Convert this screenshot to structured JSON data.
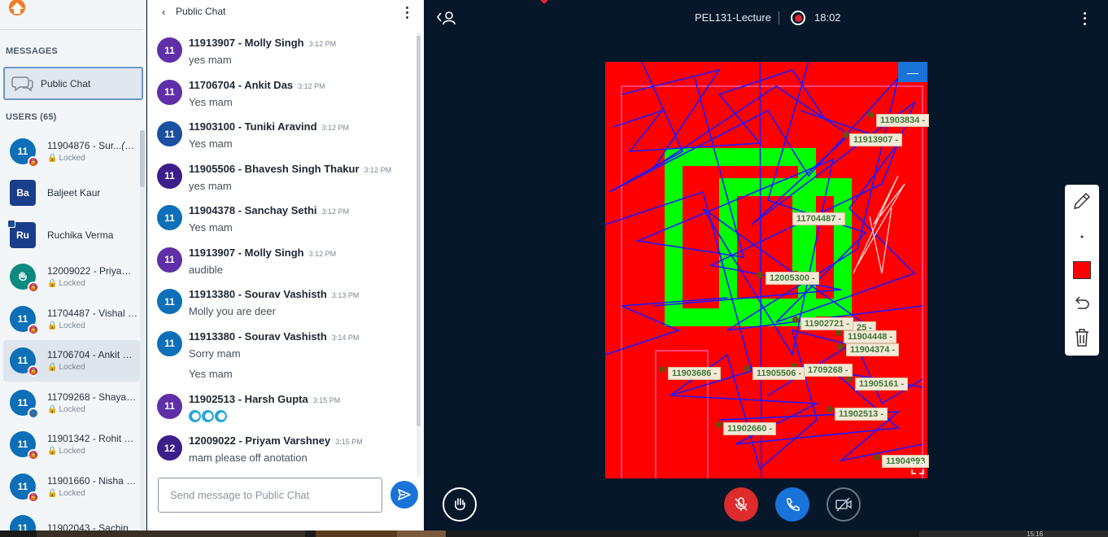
{
  "sidebar": {
    "messages_title": "MESSAGES",
    "public_chat_label": "Public Chat",
    "users_title": "USERS (65)",
    "users": [
      {
        "avatar": "11",
        "name": "11904876 - Sur...",
        "you": "(You)",
        "status": "Locked",
        "badge": "lock-red"
      },
      {
        "avatar": "Ba",
        "name": "Baljeet Kaur",
        "status": "",
        "badge": ""
      },
      {
        "avatar": "Ru",
        "name": "Ruchika Verma",
        "status": "",
        "badge": ""
      },
      {
        "avatar": "hand",
        "name": "12009022 - Priyam ...",
        "status": "Locked",
        "badge": "lock-red"
      },
      {
        "avatar": "11",
        "name": "11704487 - Vishal G...",
        "status": "Locked",
        "badge": "lock-red"
      },
      {
        "avatar": "11",
        "name": "11706704 - Ankit Das",
        "status": "Locked",
        "badge": "lock-red"
      },
      {
        "avatar": "11",
        "name": "11709268 - Shayan ...",
        "status": "Locked",
        "badge": "headset-blue"
      },
      {
        "avatar": "11",
        "name": "11901342 - Rohit M...",
        "status": "Locked",
        "badge": "lock-red"
      },
      {
        "avatar": "11",
        "name": "11901660 - Nisha K...",
        "status": "Locked",
        "badge": "lock-red"
      },
      {
        "avatar": "11",
        "name": "11902043 - Sachin V...",
        "status": "",
        "badge": ""
      }
    ]
  },
  "chat": {
    "back_label": "<",
    "title": "Public Chat",
    "messages": [
      {
        "avatar": "11",
        "name": "11913907 - Molly Singh",
        "time": "3:12 PM",
        "text": "yes mam"
      },
      {
        "avatar": "11",
        "name": "11706704 - Ankit Das",
        "time": "3:12 PM",
        "text": "Yes mam"
      },
      {
        "avatar": "11",
        "name": "11903100 - Tuniki Aravind",
        "time": "3:12 PM",
        "text": "Yes mam"
      },
      {
        "avatar": "11",
        "name": "11905506 - Bhavesh Singh Thakur",
        "time": "3:12 PM",
        "text": "yes mam"
      },
      {
        "avatar": "11",
        "name": "11904378 - Sanchay Sethi",
        "time": "3:12 PM",
        "text": "Yes mam"
      },
      {
        "avatar": "11",
        "name": "11913907 - Molly Singh",
        "time": "3:12 PM",
        "text": "audible"
      },
      {
        "avatar": "11",
        "name": "11913380 - Sourav Vashisth",
        "time": "3:13 PM",
        "text": "Molly you are deer"
      },
      {
        "avatar": "11",
        "name": "11913380 - Sourav Vashisth",
        "time": "3:14 PM",
        "text": "Sorry mam",
        "text2": "Yes mam"
      },
      {
        "avatar": "11",
        "name": "11902513 - Harsh Gupta",
        "time": "3:15 PM",
        "text": ""
      },
      {
        "avatar": "12",
        "name": "12009022 - Priyam Varshney",
        "time": "3:15 PM",
        "text": "mam please off anotation"
      }
    ],
    "input_placeholder": "Send message to Public Chat"
  },
  "presentation": {
    "title": "PEL131-Lecture",
    "recording_time": "18:02",
    "minimize_label": "—",
    "labels": [
      "11903834 -",
      "11913907 -",
      "11704487 -",
      "12005300 -",
      "11902721 -",
      "25 -",
      "11904448 -",
      "11904374 -",
      "11903686 -",
      "11905506 -",
      "1709268 -",
      "11905161 -",
      "11902513 -",
      "11902660 -",
      "11904993"
    ]
  },
  "colors": {
    "slide_bg": "#ff0000",
    "shape_green": "#00ff00",
    "ink_blue": "#1a1aff",
    "accent_blue": "#1a73d9",
    "mic_red": "#de2b2b",
    "pen_color": "#ff0000"
  },
  "icons": {
    "user_toggle": "user-list-icon",
    "record": "record-icon",
    "raise_hand": "raise-hand-icon",
    "mic": "mic-muted-icon",
    "audio": "phone-icon",
    "camera": "camera-off-icon",
    "pencil": "pencil-icon",
    "thickness": "thickness-dot-icon",
    "color": "color-swatch-icon",
    "undo": "undo-icon",
    "trash": "trash-icon"
  },
  "taskbar_time": "15:16"
}
